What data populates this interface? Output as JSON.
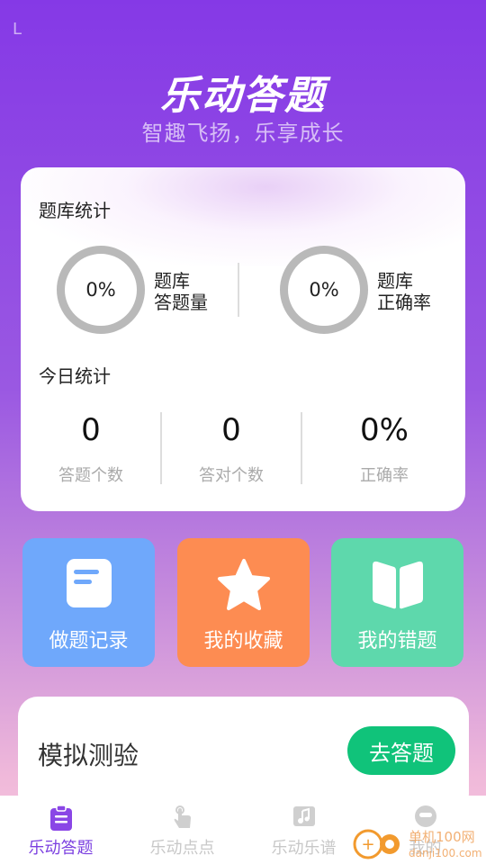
{
  "status": {
    "left_glyph": "L"
  },
  "header": {
    "title": "乐动答题",
    "subtitle": "智趣飞扬，乐享成长"
  },
  "bank_stats": {
    "title": "题库统计",
    "items": [
      {
        "value": "0%",
        "label_line1": "题库",
        "label_line2": "答题量"
      },
      {
        "value": "0%",
        "label_line1": "题库",
        "label_line2": "正确率"
      }
    ]
  },
  "today_stats": {
    "title": "今日统计",
    "items": [
      {
        "value": "0",
        "label": "答题个数"
      },
      {
        "value": "0",
        "label": "答对个数"
      },
      {
        "value": "0%",
        "label": "正确率"
      }
    ]
  },
  "tiles": [
    {
      "label": "做题记录",
      "icon": "document-icon",
      "color": "#6fa8fb"
    },
    {
      "label": "我的收藏",
      "icon": "star-icon",
      "color": "#fd8c52"
    },
    {
      "label": "我的错题",
      "icon": "book-icon",
      "color": "#5ed8ac"
    }
  ],
  "mock_test": {
    "title": "模拟测验",
    "button": "去答题"
  },
  "tabbar": {
    "items": [
      {
        "label": "乐动答题",
        "icon": "clipboard-icon",
        "active": true
      },
      {
        "label": "乐动点点",
        "icon": "tap-icon",
        "active": false
      },
      {
        "label": "乐动乐谱",
        "icon": "music-note-icon",
        "active": false
      },
      {
        "label": "我的",
        "icon": "profile-icon",
        "active": false
      }
    ]
  },
  "watermark": {
    "site": "单机100网",
    "url": "danji100.com"
  },
  "colors": {
    "accent": "#7b3fe0",
    "go_button": "#10c37a",
    "ring": "#b9b9b9"
  }
}
